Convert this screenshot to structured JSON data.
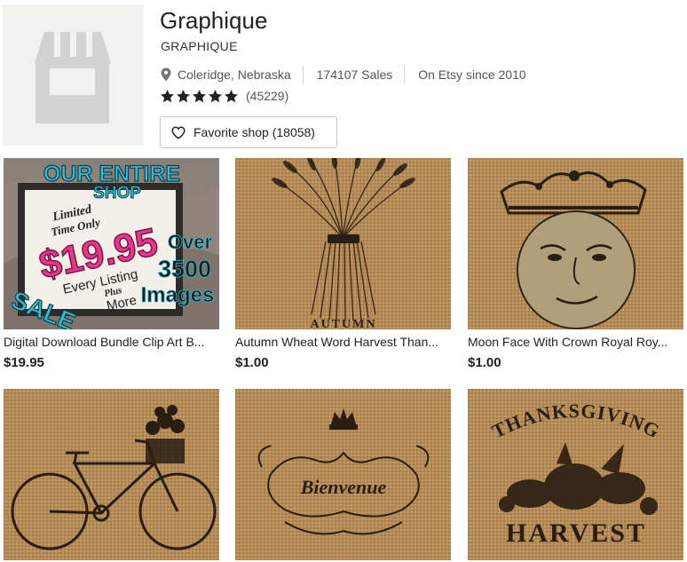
{
  "shop": {
    "name": "Graphique",
    "subtitle": "GRAPHIQUE",
    "location": "Coleridge, Nebraska",
    "sales": "174107 Sales",
    "since": "On Etsy since 2010",
    "rating_stars": 5,
    "review_count": "(45229)",
    "favorite_label": "Favorite shop (18058)"
  },
  "colors": {
    "burlap": "#b48a56",
    "ink": "#2a1d12",
    "sale_pink": "#e8378a",
    "sale_cyan": "#2bc0d8"
  },
  "icons": {
    "location": "map-pin-icon",
    "star": "star-icon",
    "favorite": "heart-icon"
  },
  "listings": [
    {
      "title": "Digital Download Bundle Clip Art B...",
      "price": "$19.95",
      "image_text": {
        "line1": "OUR ENTIRE",
        "line2": "SHOP",
        "limited1": "Limited",
        "limited2": "Time Only",
        "price": "$19.95",
        "every": "Every Listing",
        "plus": "Plus",
        "more": "More",
        "over": "Over",
        "count": "3500",
        "images": "Images",
        "sale": "SALE"
      }
    },
    {
      "title": "Autumn Wheat Word Harvest Than...",
      "price": "$1.00",
      "image_text": {
        "caption": "AUTUMN"
      }
    },
    {
      "title": "Moon Face With Crown Royal Roy...",
      "price": "$1.00"
    },
    {
      "title": "",
      "price": ""
    },
    {
      "title": "",
      "price": "",
      "image_text": {
        "word": "Bienvenue"
      }
    },
    {
      "title": "",
      "price": "",
      "image_text": {
        "top": "THANKSGIVING",
        "bottom": "HARVEST"
      }
    }
  ]
}
